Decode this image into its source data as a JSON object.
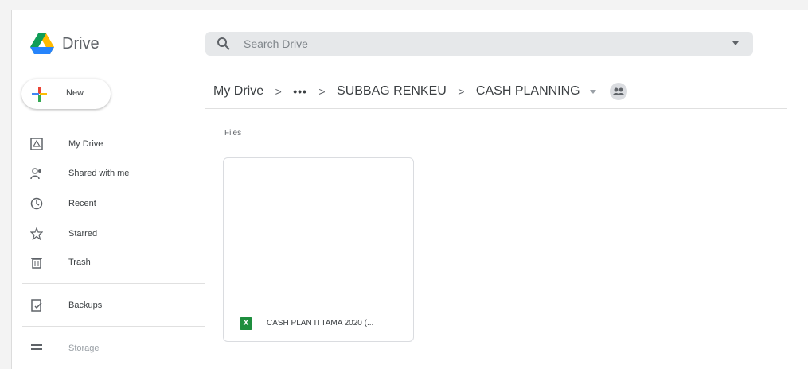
{
  "app": {
    "name": "Drive"
  },
  "search": {
    "placeholder": "Search Drive"
  },
  "sidebar": {
    "new_label": "New",
    "items": [
      {
        "label": "My Drive",
        "icon": "my-drive-icon"
      },
      {
        "label": "Shared with me",
        "icon": "shared-icon"
      },
      {
        "label": "Recent",
        "icon": "clock-icon"
      },
      {
        "label": "Starred",
        "icon": "star-icon"
      },
      {
        "label": "Trash",
        "icon": "trash-icon"
      },
      {
        "label": "Backups",
        "icon": "backup-icon"
      },
      {
        "label": "Storage",
        "icon": "storage-icon"
      }
    ]
  },
  "breadcrumb": {
    "root": "My Drive",
    "ellipsis": "•••",
    "parent": "SUBBAG RENKEU",
    "current": "CASH PLANNING"
  },
  "main": {
    "section_title": "Files",
    "files": [
      {
        "name": "CASH PLAN ITTAMA 2020 (...",
        "type_badge": "X"
      }
    ]
  },
  "colors": {
    "sheets_green": "#1e8e3e"
  }
}
